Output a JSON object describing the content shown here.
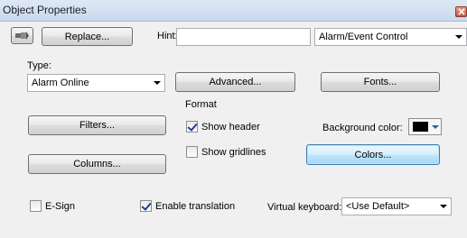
{
  "window": {
    "title": "Object Properties"
  },
  "toolbar": {
    "replace_label": "Replace...",
    "hint_label": "Hint:",
    "hint_value": "",
    "control_select": "Alarm/Event Control"
  },
  "type_section": {
    "label": "Type:",
    "value": "Alarm Online"
  },
  "buttons": {
    "advanced": "Advanced...",
    "fonts": "Fonts...",
    "filters": "Filters...",
    "columns": "Columns...",
    "colors": "Colors..."
  },
  "format": {
    "title": "Format",
    "show_header": {
      "label": "Show header",
      "checked": true
    },
    "show_gridlines": {
      "label": "Show gridlines",
      "checked": false
    },
    "background_label": "Background color:",
    "background_color": "#000000"
  },
  "bottom": {
    "esign": {
      "label": "E-Sign",
      "checked": false
    },
    "enable_translation": {
      "label": "Enable translation",
      "checked": true
    },
    "keyboard_label": "Virtual keyboard:",
    "keyboard_value": "<Use Default>"
  },
  "icons": [
    "pin-icon",
    "close-icon",
    "chevron-down-icon",
    "checkbox-icon"
  ],
  "colors": {
    "titlebar": "#c8d9ee",
    "window_bg": "#f0f0f0",
    "close": "#c8573f"
  }
}
